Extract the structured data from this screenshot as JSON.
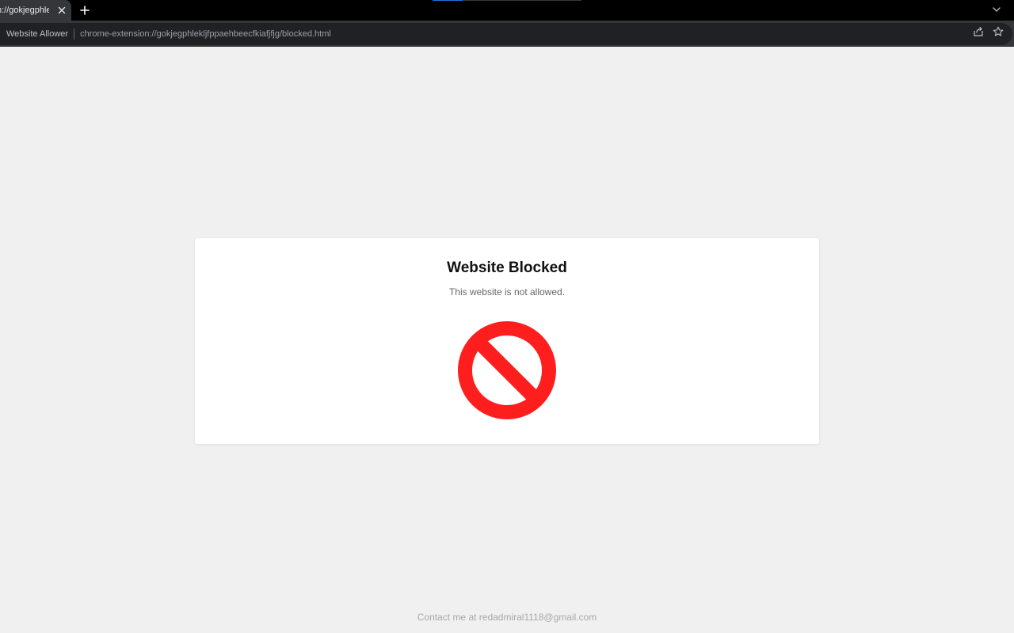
{
  "browser": {
    "tab": {
      "title": "n://gokjegphlek",
      "close_icon": "close-icon"
    },
    "new_tab_icon": "plus-icon",
    "tab_search_icon": "chevron-down-icon",
    "omnibox": {
      "origin_label": "Website Allower",
      "url": "chrome-extension://gokjegphlekljfppaehbeecfkiafjfjg/blocked.html",
      "share_icon": "share-icon",
      "bookmark_icon": "star-icon"
    }
  },
  "page": {
    "title": "Website Blocked",
    "message": "This website is not allowed.",
    "icon": "prohibited-icon",
    "footer": "Contact me at redadmiral1118@gmail.com"
  },
  "colors": {
    "block_red": "#ff1e1e",
    "page_bg": "#f0f0f0",
    "card_bg": "#ffffff"
  }
}
